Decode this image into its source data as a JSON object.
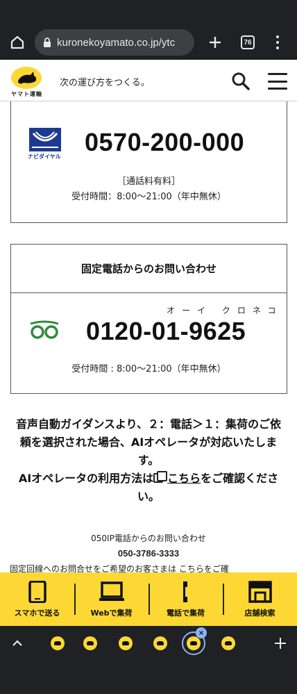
{
  "browser": {
    "url": "kuronekoyamato.co.jp/ytc",
    "tab_count": "76",
    "new_tab_label": "+"
  },
  "header": {
    "logo_caption": "ヤマト運輸",
    "tagline": "次の運び方をつくる。"
  },
  "navi_dial": {
    "logo_caption": "ナビダイヤル",
    "number": "0570-200-000",
    "fee_note": "［通話料有料］",
    "hours": "受付時間：8:00〜21:00（年中無休）"
  },
  "landline": {
    "heading": "固定電話からのお問い合わせ",
    "kana": "オーイ クロネコ",
    "number": "0120-01-9625",
    "hours": "受付時間 : 8:00〜21:00（年中無休）"
  },
  "guidance": {
    "text1": "音声自動ガイダンスより、２：電話＞１：集荷のご依頼を選択された場合、AIオペレータが対応いたします。",
    "text2_prefix": "AIオペレータの利用方法は",
    "link": "こちら",
    "text2_suffix": "をご確認ください。"
  },
  "ip_phone": {
    "label": "050IP電話からのお問い合わせ",
    "number": "050-3786-3333",
    "cut_line": "固定回線へのお問合せをご希望のお客さまは こちらをご確"
  },
  "bottom_nav": [
    {
      "label": "スマホで送る",
      "icon": "smartphone-icon"
    },
    {
      "label": "Webで集荷",
      "icon": "laptop-icon"
    },
    {
      "label": "電話で集荷",
      "icon": "phone-handset-icon"
    },
    {
      "label": "店舗検索",
      "icon": "store-icon"
    }
  ],
  "colors": {
    "brand_yellow": "#fdd835",
    "chrome_dark": "#202124",
    "navi_blue": "#1c3a8f",
    "freedial_green": "#2e8b3a"
  }
}
